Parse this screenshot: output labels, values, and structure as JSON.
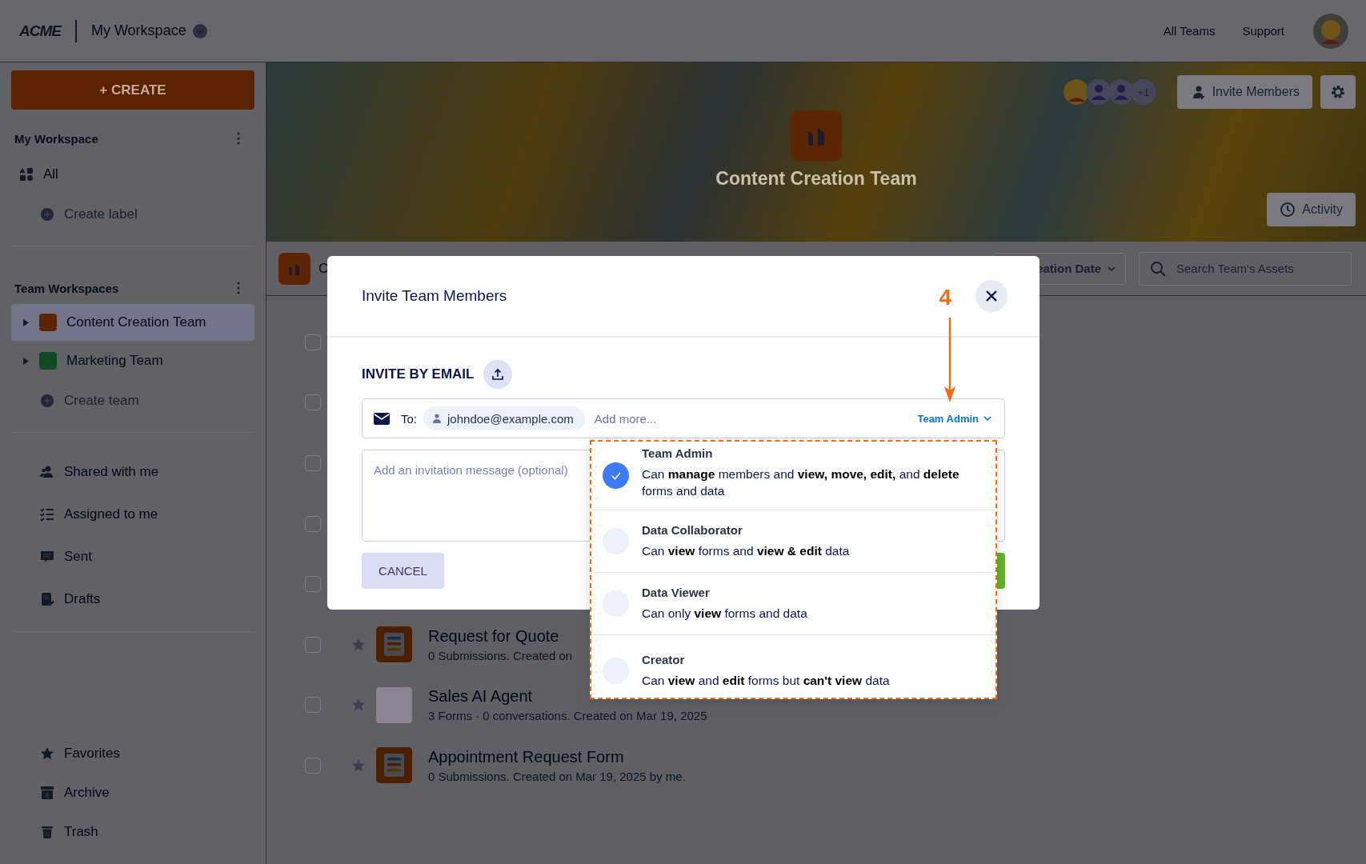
{
  "top_bar": {
    "logo": "ACME",
    "workspace": "My Workspace",
    "links": [
      "All Teams",
      "Support"
    ]
  },
  "sidebar": {
    "create_button": "+ CREATE",
    "my_workspace": {
      "title": "My Workspace",
      "items": [
        {
          "label": "All",
          "kind": "filter"
        },
        {
          "label": "Create label",
          "kind": "create"
        }
      ]
    },
    "team_workspaces": {
      "title": "Team Workspaces",
      "teams": [
        {
          "label": "Content Creation Team",
          "selected": true,
          "expanded": false,
          "color": "#5c2604"
        },
        {
          "label": "Marketing Team",
          "selected": false,
          "expanded": false,
          "color": "#0e4a22"
        }
      ],
      "create": "Create team"
    },
    "nav": [
      "Shared with me",
      "Assigned to me",
      "Sent",
      "Drafts"
    ],
    "bottom_nav": [
      "Favorites",
      "Archive",
      "Trash"
    ]
  },
  "team_header": {
    "title": "Content Creation Team",
    "member_overflow": "+1",
    "invite_button": "Invite Members",
    "activity_button": "Activity"
  },
  "toolbar": {
    "breadcrumb": "C",
    "sort": "eation Date",
    "search_placeholder": "Search Team's Assets"
  },
  "assets": [
    {
      "checked": false
    },
    {
      "checked": false
    },
    {
      "checked": false
    },
    {
      "checked": false
    },
    {
      "checked": false
    },
    {
      "checked": false,
      "kind": "form",
      "title": "Request for Quote",
      "meta": "0 Submissions. Created on"
    },
    {
      "checked": false,
      "kind": "agent",
      "title": "Sales AI Agent",
      "meta": "3 Forms · 0 conversations. Created on Mar 19, 2025"
    },
    {
      "checked": false,
      "kind": "form",
      "title": "Appointment Request Form",
      "meta": "0 Submissions. Created on Mar 19, 2025 by me."
    }
  ],
  "modal": {
    "title": "Invite Team Members",
    "step_marker": "4",
    "section_title": "INVITE BY EMAIL",
    "to_label": "To:",
    "recipients": [
      "johndoe@example.com"
    ],
    "add_more_placeholder": "Add more...",
    "role_button": "Team Admin",
    "message_placeholder": "Add an invitation message (optional)",
    "cancel_button": "CANCEL"
  },
  "role_menu": {
    "options": [
      {
        "name": "Team Admin",
        "description": "Can **manage** members and **view, move, edit,** and **delete** forms and data",
        "selected": true
      },
      {
        "name": "Data Collaborator",
        "description": "Can **view** forms and **view & edit** data",
        "selected": false
      },
      {
        "name": "Data Viewer",
        "description": "Can only **view** forms and data",
        "selected": false
      },
      {
        "name": "Creator",
        "description": "Can **view** and **edit** forms but **can't view** data",
        "selected": false
      }
    ]
  }
}
